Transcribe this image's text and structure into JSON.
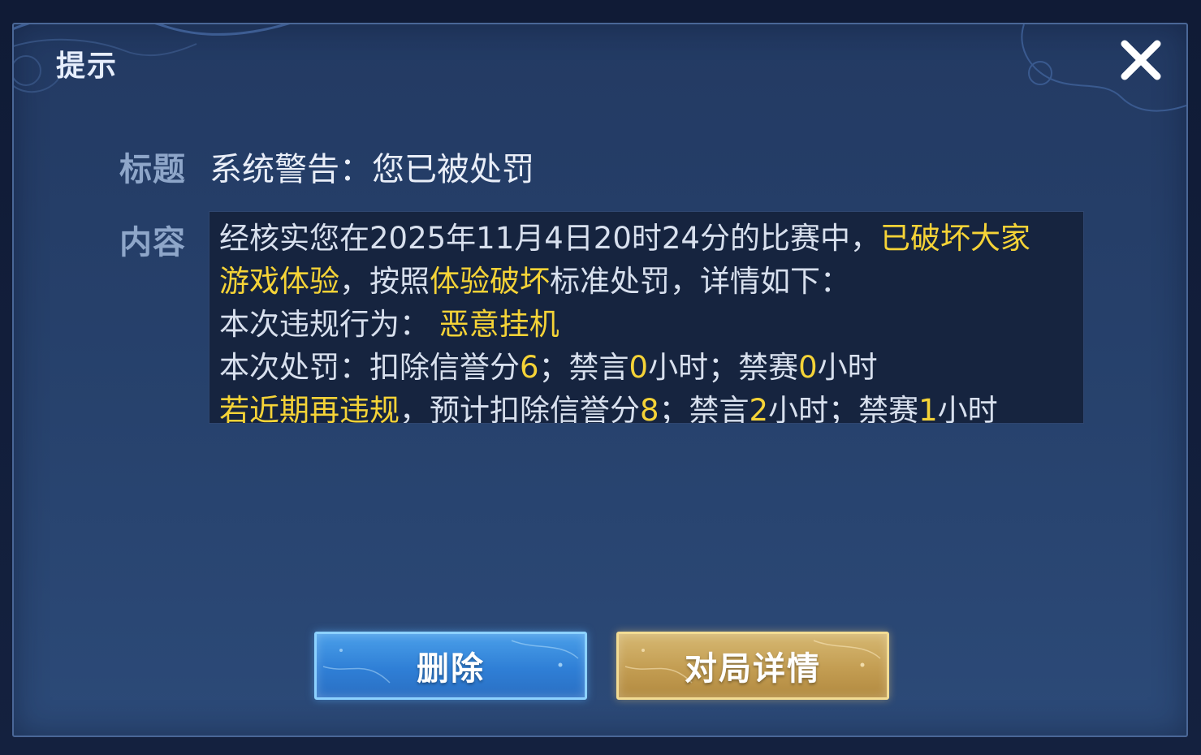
{
  "dialog": {
    "title": "提示",
    "close_icon": "close-icon"
  },
  "message": {
    "title_label": "标题",
    "title_value": "系统警告：您已被处罚",
    "content_label": "内容",
    "content_lines": [
      [
        {
          "text": "经核实您在2025年11月4日20时24分的比赛中，",
          "highlight": false
        },
        {
          "text": "已破坏大家",
          "highlight": true
        }
      ],
      [
        {
          "text": "游戏体验",
          "highlight": true
        },
        {
          "text": "，按照",
          "highlight": false
        },
        {
          "text": "体验破坏",
          "highlight": true
        },
        {
          "text": "标准处罚，详情如下：",
          "highlight": false
        }
      ],
      [
        {
          "text": "本次违规行为：",
          "highlight": false
        },
        {
          "text": " 恶意挂机",
          "highlight": true
        }
      ],
      [
        {
          "text": "本次处罚：扣除信誉分",
          "highlight": false
        },
        {
          "text": "6",
          "highlight": true
        },
        {
          "text": "；禁言",
          "highlight": false
        },
        {
          "text": "0",
          "highlight": true
        },
        {
          "text": "小时；禁赛",
          "highlight": false
        },
        {
          "text": "0",
          "highlight": true
        },
        {
          "text": "小时",
          "highlight": false
        }
      ],
      [
        {
          "text": "若近期再违规",
          "highlight": true
        },
        {
          "text": "，预计扣除信誉分",
          "highlight": false
        },
        {
          "text": "8",
          "highlight": true
        },
        {
          "text": "；禁言",
          "highlight": false
        },
        {
          "text": "2",
          "highlight": true
        },
        {
          "text": "小时；禁赛",
          "highlight": false
        },
        {
          "text": "1",
          "highlight": true
        },
        {
          "text": "小时",
          "highlight": false
        }
      ]
    ]
  },
  "buttons": {
    "delete_label": "删除",
    "details_label": "对局详情"
  },
  "colors": {
    "highlight": "#f5d337",
    "text": "#d8e0ee",
    "label": "#8ea6c9",
    "delete_button": "#2f7fd6",
    "details_button": "#c39d52"
  }
}
